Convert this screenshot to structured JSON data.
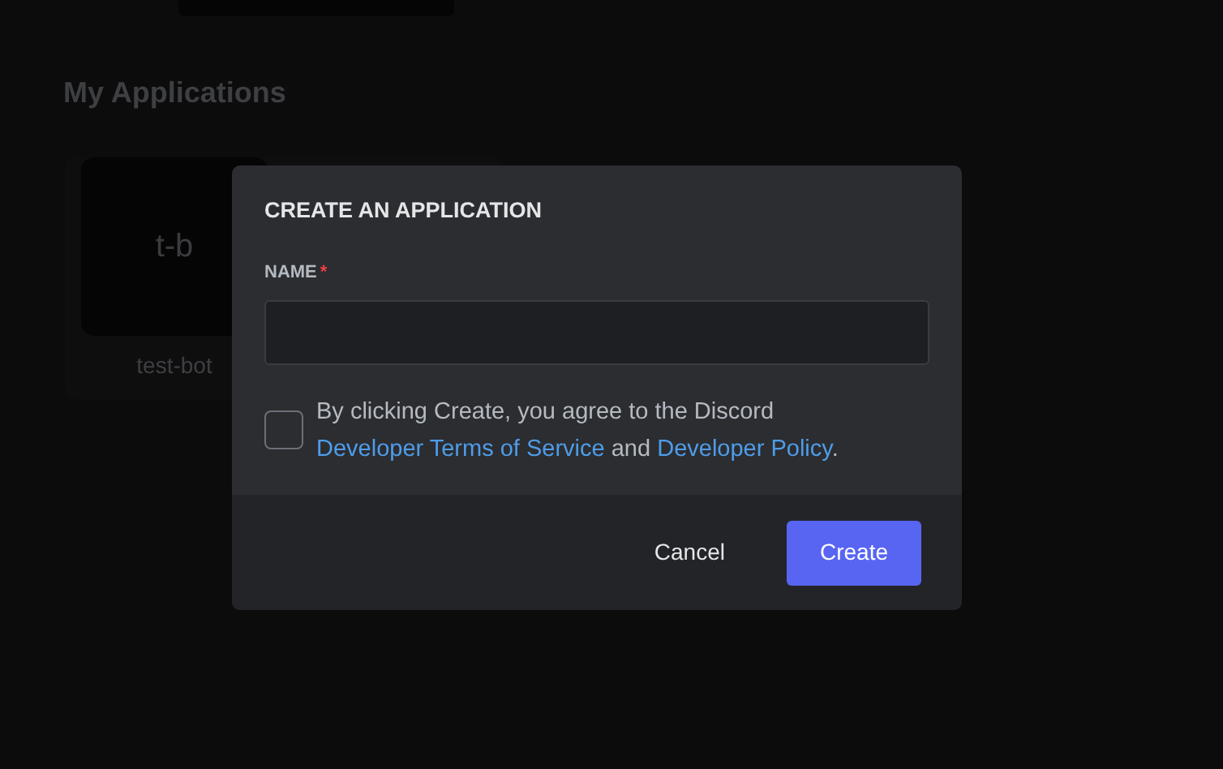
{
  "page": {
    "heading": "My Applications",
    "apps": [
      {
        "initials": "t-b",
        "name": "test-bot"
      }
    ]
  },
  "dialog": {
    "title": "CREATE AN APPLICATION",
    "field": {
      "label": "NAME",
      "required_mark": "*"
    },
    "agreement": {
      "checked": false,
      "parts": [
        {
          "kind": "text",
          "text": "By clicking Create, you agree to the Discord "
        },
        {
          "kind": "link",
          "text": "Developer Terms of Service"
        },
        {
          "kind": "text",
          "text": " and "
        },
        {
          "kind": "link",
          "text": "Developer Policy"
        },
        {
          "kind": "text",
          "text": "."
        }
      ]
    },
    "buttons": [
      {
        "kind": "link",
        "label": "Cancel"
      },
      {
        "kind": "primary",
        "label": "Create"
      }
    ]
  }
}
